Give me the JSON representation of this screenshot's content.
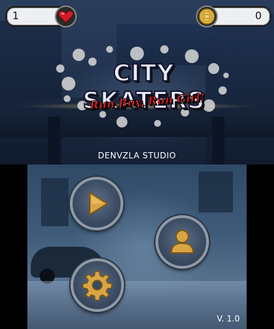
{
  "hud": {
    "lives": "1",
    "coins": "0",
    "lives_icon": "heart-icon",
    "coins_icon": "coin-icon"
  },
  "logo": {
    "title": "CITY SKATERS",
    "subtitle": "Run Boy, Run Girl!"
  },
  "studio": "DENVZLA STUDIO",
  "menu": {
    "play_icon": "play-icon",
    "profile_icon": "user-icon",
    "settings_icon": "gear-icon"
  },
  "version": "V. 1.0",
  "colors": {
    "accent_gold": "#d9a544",
    "heart_red": "#d11a2a",
    "subtitle_red": "#dd2222"
  }
}
